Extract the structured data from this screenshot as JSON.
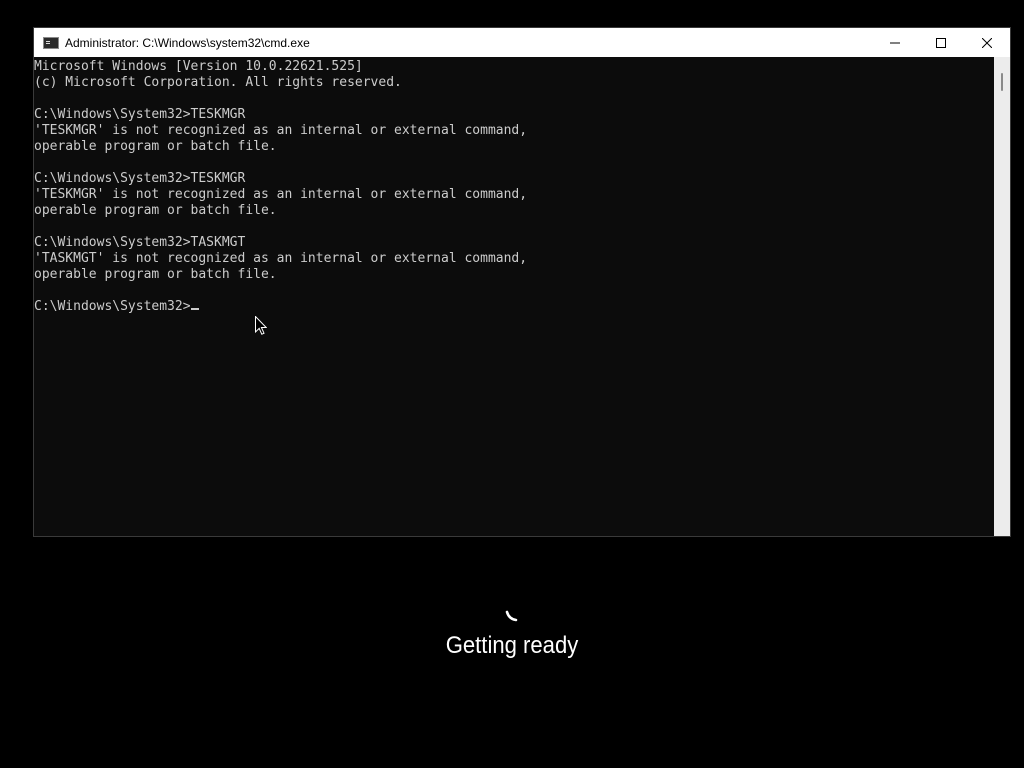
{
  "window": {
    "title": "Administrator: C:\\Windows\\system32\\cmd.exe",
    "icon": "cmd-app-icon",
    "controls": {
      "minimize": "minimize-icon",
      "maximize": "maximize-icon",
      "close": "close-icon"
    }
  },
  "console": {
    "lines": [
      "Microsoft Windows [Version 10.0.22621.525]",
      "(c) Microsoft Corporation. All rights reserved.",
      "",
      "C:\\Windows\\System32>TESKMGR",
      "'TESKMGR' is not recognized as an internal or external command,",
      "operable program or batch file.",
      "",
      "C:\\Windows\\System32>TESKMGR",
      "'TESKMGR' is not recognized as an internal or external command,",
      "operable program or batch file.",
      "",
      "C:\\Windows\\System32>TASKMGT",
      "'TASKMGT' is not recognized as an internal or external command,",
      "operable program or batch file.",
      ""
    ],
    "prompt": "C:\\Windows\\System32>",
    "input": ""
  },
  "boot": {
    "status_text": "Getting ready",
    "spinner_icon": "loading-spinner-icon"
  },
  "colors": {
    "console_bg": "#0c0c0c",
    "console_fg": "#cccccc",
    "titlebar_bg": "#ffffff",
    "desktop_bg": "#000000",
    "status_fg": "#ffffff"
  }
}
